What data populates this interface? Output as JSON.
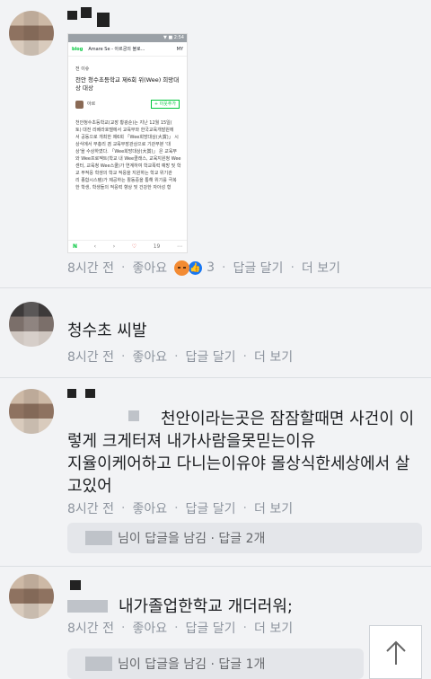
{
  "comments": [
    {
      "image": {
        "status_text": "▼ ■ 2:54",
        "blog_label": "blog",
        "blog_title": "Amare Se - 아르궁의 블로...",
        "blog_my": "MY",
        "category": "전 이슈",
        "post_title": "천안 청수초등학교 제6회 위(Wee) 희망대상 대상",
        "author": "아르",
        "follow_label": "+ 이웃추가",
        "body_lines": [
          "천안청수초등학교(교장 황광순)는 지난 12월 15일(",
          "토) 대전 리베라호텔에서 교육부와 한국교육개발원에",
          "서 공동으로 개최한 제6회 「Wee희망대상(大賞)」 시",
          "상식에서 부총리 겸 교육부장관상으로 기관부분 '대",
          "상'을 수상하였다.  「Wee희망대상(大賞)」 은 교육부",
          "와 Wee프로젝트(학교 내 Wee클래스, 교육지원청 Wee",
          "센터, 교육청 Wee스쿨)가 연계하여 학교폭력 예방 및 학",
          "교 부적응 학생의 학교 적응을 지원하는 학교 위기관",
          "리 종합시스템)가 제공하는 활동중을 통해 위기를 극복",
          "한 학생, 학생들의 적응력 향상 및 건강한 자아성 형"
        ],
        "foot_likes": "19"
      },
      "time": "8시간 전",
      "like": "좋아요",
      "reaction_count": "3",
      "reply": "답글 달기",
      "more": "더 보기"
    },
    {
      "text": "청수초 씨발",
      "time": "8시간 전",
      "like": "좋아요",
      "reply": "답글 달기",
      "more": "더 보기"
    },
    {
      "text_lines": [
        "천안이라는곳은 잠잠할때면 사건이 이",
        "렇게 크게터져 내가사람을못믿는이유",
        "지율이케어하고 다니는이유야 몰상식한세상에서 살",
        "고있어"
      ],
      "time": "8시간 전",
      "like": "좋아요",
      "reply": "답글 달기",
      "more": "더 보기",
      "reply_summary": "님이 답글을 남김 · 답글 2개"
    },
    {
      "text": "내가졸업한학교 개더러워;",
      "time": "8시간 전",
      "like": "좋아요",
      "reply": "답글 달기",
      "more": "더 보기",
      "reply_summary": "님이 답글을 남김 · 답글 1개"
    }
  ],
  "scroll_top_icon": "arrow-up-icon",
  "colors": {
    "background": "#f2f3f5",
    "meta_text": "#8d949e",
    "like_blue": "#1877f2",
    "angry_orange": "#f38b33",
    "naver_green": "#00c73c"
  }
}
